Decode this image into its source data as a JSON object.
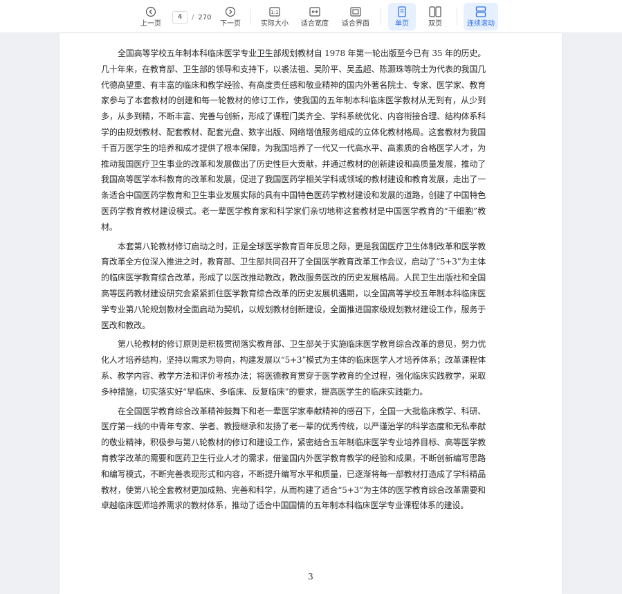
{
  "toolbar": {
    "prev_label": "上一页",
    "next_label": "下一页",
    "current_page": "4",
    "page_separator": "/",
    "total_pages": "270",
    "actual_size_label": "实际大小",
    "fit_width_label": "适合宽度",
    "fit_page_label": "适合界面",
    "single_page_label": "单页",
    "double_page_label": "双页",
    "continuous_label": "连续滚动",
    "accent_color": "#2f6fe4",
    "active_bg": "#e6f0ff"
  },
  "document": {
    "paragraphs": [
      "全国高等学校五年制本科临床医学专业卫生部规划教材自 1978 年第一轮出版至今已有 35 年的历史。几十年来，在教育部、卫生部的领导和支持下，以裘法祖、吴阶平、吴孟超、陈灏珠等院士为代表的我国几代德高望重、有丰富的临床和教学经验、有高度责任感和敬业精神的国内外著名院士、专家、医学家、教育家参与了本套教材的创建和每一轮教材的修订工作，使我国的五年制本科临床医学教材从无到有，从少到多，从多到精，不断丰富、完善与创新，形成了课程门类齐全、学科系统优化、内容衔接合理、结构体系科学的由规划教材、配套教材、配套光盘、数字出版、网络增值服务组成的立体化教材格局。这套教材为我国千百万医学生的培养和成才提供了根本保障，为我国培养了一代又一代高水平、高素质的合格医学人才，为推动我国医疗卫生事业的改革和发展做出了历史性巨大贡献，并通过教材的创新建设和高质量发展，推动了我国高等医学本科教育的改革和发展，促进了我国医药学相关学科或领域的教材建设和教育发展，走出了一条适合中国医药学教育和卫生事业发展实际的具有中国特色医药学教材建设和发展的道路，创建了中国特色医药学教育教材建设模式。老一辈医学教育家和科学家们亲切地称这套教材是中国医学教育的“干细胞”教材。",
      "本套第八轮教材修订启动之时，正是全球医学教育百年反思之际，更是我国医疗卫生体制改革和医学教育改革全方位深入推进之时，教育部、卫生部共同召开了全国医学教育改革工作会议，启动了“5+3”为主体的临床医学教育综合改革，形成了以医改推动教改，教改服务医改的历史发展格局。人民卫生出版社和全国高等医药教材建设研究会紧紧抓住医学教育综合改革的历史发展机遇期，以全国高等学校五年制本科临床医学专业第八轮规划教材全面启动为契机，以规划教材创新建设，全面推进国家级规划教材建设工作，服务于医改和教改。",
      "第八轮教材的修订原则是积极贯彻落实教育部、卫生部关于实施临床医学教育综合改革的意见，努力优化人才培养结构，坚持以需求为导向，构建发展以“5+3”模式为主体的临床医学人才培养体系；改革课程体系、教学内容、教学方法和评价考核办法；将医德教育贯穿于医学教育的全过程，强化临床实践教学，采取多种措施，切实落实好“早临床、多临床、反复临床”的要求，提高医学生的临床实践能力。",
      "在全国医学教育综合改革精神鼓舞下和老一辈医学家奉献精神的感召下，全国一大批临床教学、科研、医疗第一线的中青年专家、学者、教授继承和发扬了老一辈的优秀传统，以严谨治学的科学态度和无私奉献的敬业精神，积极参与第八轮教材的修订和建设工作，紧密结合五年制临床医学专业培养目标、高等医学教育教学改革的需要和医药卫生行业人才的需求，借鉴国内外医学教育教学的经验和成果，不断创新编写思路和编写模式，不断完善表现形式和内容，不断提升编写水平和质量，已逐渐将每一部教材打造成了学科精品教材，使第八轮全套教材更加成熟、完善和科学，从而构建了适合“5+3”为主体的医学教育综合改革需要和卓越临床医师培养需求的教材体系，推动了适合中国国情的五年制本科临床医学专业课程体系的建设。"
    ],
    "page_number": "3"
  }
}
